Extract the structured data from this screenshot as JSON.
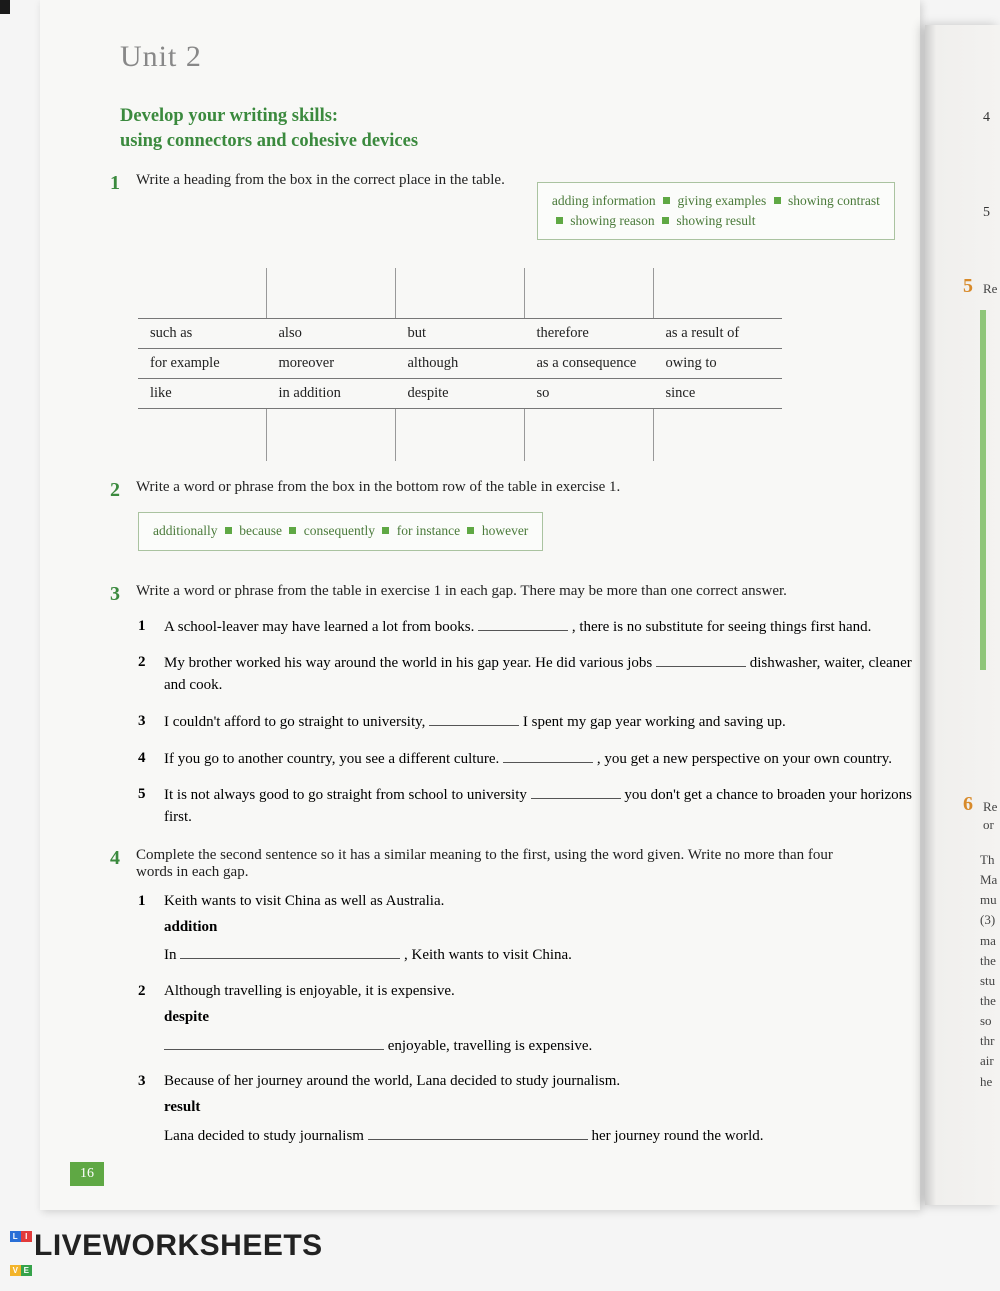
{
  "unit_title": "Unit 2",
  "section_title_1": "Develop your writing skills:",
  "section_title_2": "using connectors and cohesive devices",
  "ex1": {
    "num": "1",
    "instr": "Write a heading from the box in the correct place in the table.",
    "box": [
      "adding information",
      "giving examples",
      "showing contrast",
      "showing reason",
      "showing result"
    ],
    "table": [
      [
        "such as",
        "also",
        "but",
        "therefore",
        "as a result of"
      ],
      [
        "for example",
        "moreover",
        "although",
        "as a consequence",
        "owing to"
      ],
      [
        "like",
        "in addition",
        "despite",
        "so",
        "since"
      ]
    ]
  },
  "ex2": {
    "num": "2",
    "instr": "Write a word or phrase from the box in the bottom row of the table in exercise 1.",
    "box": [
      "additionally",
      "because",
      "consequently",
      "for instance",
      "however"
    ]
  },
  "ex3": {
    "num": "3",
    "instr": "Write a word or phrase from the table in exercise 1 in each gap. There may be more than one correct answer.",
    "items": [
      {
        "n": "1",
        "text_a": "A school-leaver may have learned a lot from books. ",
        "text_b": " , there is no substitute for seeing things first hand."
      },
      {
        "n": "2",
        "text_a": "My brother worked his way around the world in his gap year. He did various jobs ",
        "text_b": " dishwasher, waiter, cleaner and cook."
      },
      {
        "n": "3",
        "text_a": "I couldn't afford to go straight to university, ",
        "text_b": " I spent my gap year working and saving up."
      },
      {
        "n": "4",
        "text_a": "If you go to another country, you see a different culture. ",
        "text_b": " , you get a new perspective on your own country."
      },
      {
        "n": "5",
        "text_a": "It is not always good to go straight from school to university ",
        "text_b": " you don't get a chance to broaden your horizons first."
      }
    ]
  },
  "ex4": {
    "num": "4",
    "instr": "Complete the second sentence so it has a similar meaning to the first, using the word given. Write no more than four words in each gap.",
    "items": [
      {
        "n": "1",
        "sent": "Keith wants to visit China as well as Australia.",
        "word": "addition",
        "pre": "In ",
        "post": " , Keith wants to visit China."
      },
      {
        "n": "2",
        "sent": "Although travelling is enjoyable, it is expensive.",
        "word": "despite",
        "pre": "",
        "post": " enjoyable, travelling is expensive."
      },
      {
        "n": "3",
        "sent": "Because of her journey around the world, Lana decided to study journalism.",
        "word": "result",
        "pre": "Lana decided to study journalism ",
        "post": " her journey round the world."
      }
    ]
  },
  "page_num": "16",
  "brand": "LIVEWORKSHEETS",
  "right_page": {
    "n4": "4",
    "n5a": "5",
    "n5b": "5",
    "t5b": "Re",
    "n6": "6",
    "t6": "Re",
    "t6b": "or",
    "lines": [
      "Th",
      "Ma",
      "mu",
      "(3)",
      "ma",
      "the",
      "stu",
      "the",
      "so",
      "thr",
      "air",
      "he"
    ]
  }
}
